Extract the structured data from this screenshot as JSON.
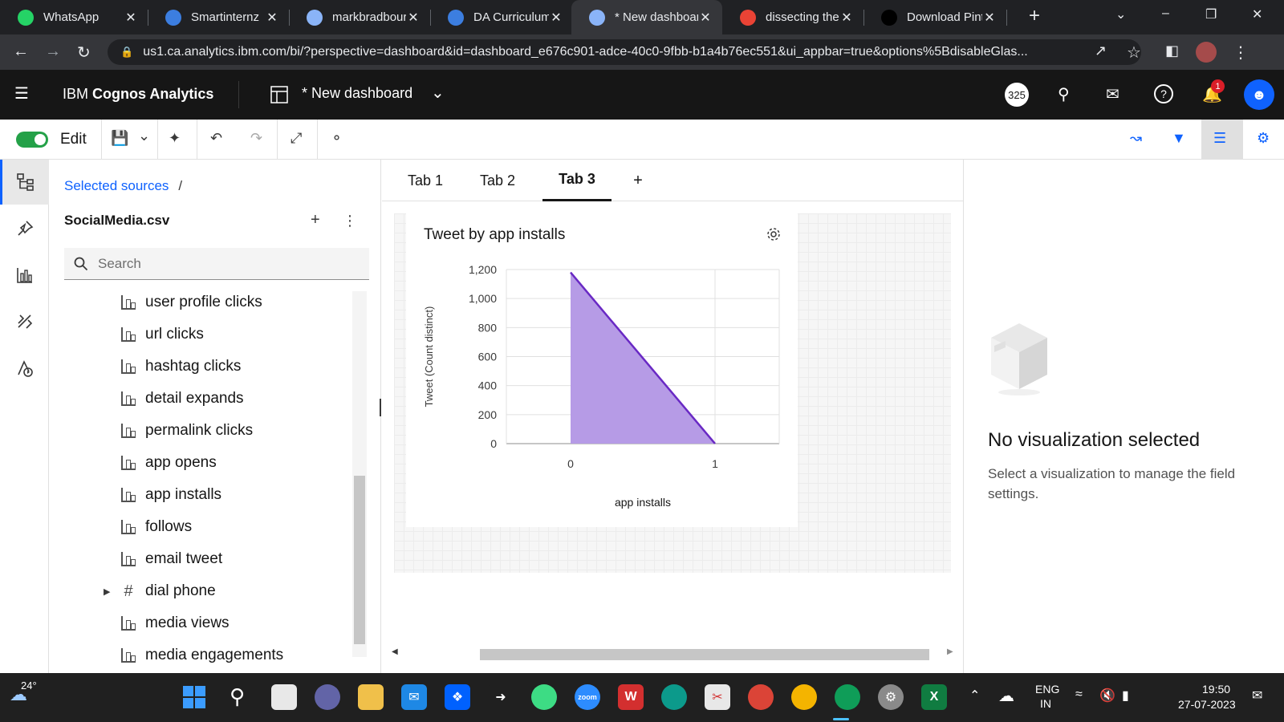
{
  "browser": {
    "tabs": [
      {
        "title": "WhatsApp",
        "icon": "whatsapp-icon",
        "color": "#25d366"
      },
      {
        "title": "Smartinternz",
        "icon": "page-icon",
        "color": "#3c7ee0"
      },
      {
        "title": "markbradbourn",
        "icon": "avatar-icon",
        "color": "#8ab4f8"
      },
      {
        "title": "DA Curriculum",
        "icon": "page-icon",
        "color": "#3c7ee0"
      },
      {
        "title": "* New dashboard",
        "icon": "cognos-icon",
        "color": "#8ab4f8"
      },
      {
        "title": "dissecting the",
        "icon": "google-icon",
        "color": "#ea4335"
      },
      {
        "title": "Download Pint",
        "icon": "g-icon",
        "color": "#000000"
      }
    ],
    "new_tab": "+",
    "url": "us1.ca.analytics.ibm.com/bi/?perspective=dashboard&id=dashboard_e676c901-adce-40c0-9fbb-b1a4b76ec551&ui_appbar=true&options%5BdisableGlas..."
  },
  "app": {
    "brand_prefix": "IBM ",
    "brand_name": "Cognos Analytics",
    "dashboard_name": "* New dashboard",
    "counter_badge": "325",
    "notification_count": "1"
  },
  "toolbar": {
    "edit_label": "Edit",
    "edit_on": true
  },
  "sources": {
    "breadcrumb": "Selected sources",
    "breadcrumb_sep": "/",
    "file": "SocialMedia.csv",
    "search_placeholder": "Search",
    "fields": [
      {
        "label": "user profile clicks",
        "type": "dim"
      },
      {
        "label": "url clicks",
        "type": "dim"
      },
      {
        "label": "hashtag clicks",
        "type": "dim"
      },
      {
        "label": "detail expands",
        "type": "dim"
      },
      {
        "label": "permalink clicks",
        "type": "dim"
      },
      {
        "label": "app opens",
        "type": "dim"
      },
      {
        "label": "app installs",
        "type": "dim"
      },
      {
        "label": "follows",
        "type": "dim"
      },
      {
        "label": "email tweet",
        "type": "dim"
      },
      {
        "label": "dial phone",
        "type": "num"
      },
      {
        "label": "media views",
        "type": "dim"
      },
      {
        "label": "media engagements",
        "type": "dim"
      }
    ]
  },
  "canvas": {
    "tabs": [
      "Tab 1",
      "Tab 2",
      "Tab 3"
    ],
    "active_tab": 2,
    "add_tab": "+",
    "widget_title": "Tweet by app installs"
  },
  "chart_data": {
    "type": "area",
    "title": "Tweet by app installs",
    "x": [
      0,
      1
    ],
    "values": [
      1180,
      0
    ],
    "x_ticks": [
      "0",
      "1"
    ],
    "y_ticks": [
      "0",
      "200",
      "400",
      "600",
      "800",
      "1,000",
      "1,200"
    ],
    "xlabel": "app installs",
    "ylabel": "Tweet (Count distinct)",
    "ylim": [
      0,
      1200
    ],
    "grid": true,
    "fill_color": "#b69be6",
    "line_color": "#6929c4"
  },
  "properties": {
    "title": "No visualization selected",
    "subtitle": "Select a visualization to manage the field settings."
  },
  "taskbar": {
    "weather": "24°",
    "lang_top": "ENG",
    "lang_bottom": "IN",
    "time": "19:50",
    "date": "27-07-2023"
  }
}
